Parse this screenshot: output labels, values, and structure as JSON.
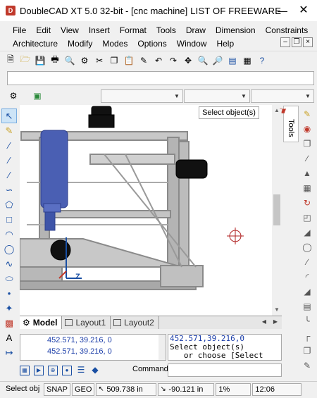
{
  "window": {
    "title": "DoubleCAD XT 5.0 32-bit - [cnc machine]",
    "overlay_text": "LIST OF FREEWARE"
  },
  "menu_row1": [
    "File",
    "Edit",
    "View",
    "Insert",
    "Format",
    "Tools",
    "Draw",
    "Dimension",
    "Constraints"
  ],
  "menu_row2": [
    "Architecture",
    "Modify",
    "Modes",
    "Options",
    "Window",
    "Help"
  ],
  "viewport": {
    "tooltip": "Select object(s)"
  },
  "side_panel": {
    "tab_label": "Tools"
  },
  "layout_tabs": [
    "Model",
    "Layout1",
    "Layout2"
  ],
  "history": [
    "452.571, 39.216, 0",
    "452.571, 39.216, 0"
  ],
  "command_output": [
    "452.571,39.216,0",
    "Select object(s)",
    "   or choose [Select"
  ],
  "command": {
    "label": "Command:"
  },
  "status": {
    "mode": "Select obj",
    "snap": "SNAP",
    "geo": "GEO",
    "x": "509.738 in",
    "y": "-90.121 in",
    "zoom": "1%",
    "time": "12:06"
  },
  "colors": {
    "accent": "#1a4fa3",
    "tab_active": "#ffffff",
    "toolbar_bg": "#f0f0f0"
  }
}
